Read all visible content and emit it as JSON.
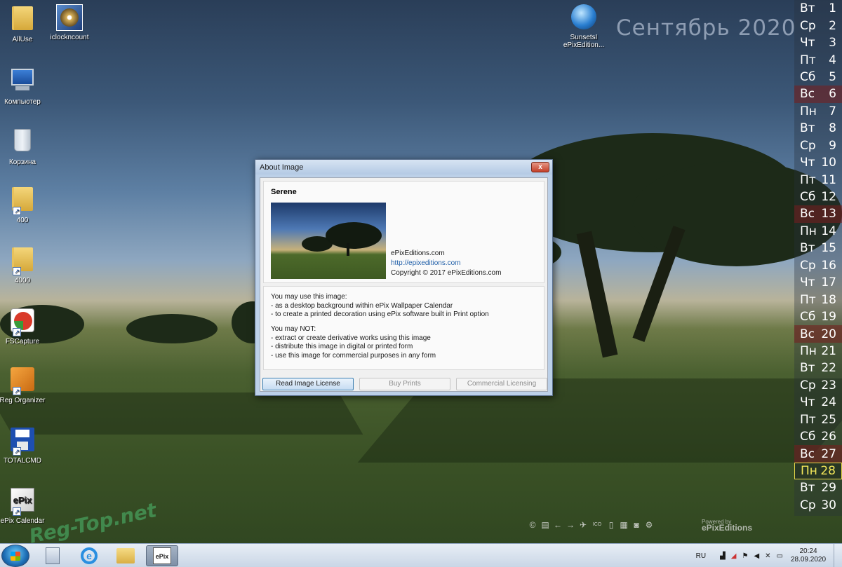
{
  "desktop": {
    "icons": [
      {
        "label": "AllUse"
      },
      {
        "label": "iclockncount"
      },
      {
        "label": "Компьютер"
      },
      {
        "label": "Корзина"
      },
      {
        "label": "400"
      },
      {
        "label": "4000"
      },
      {
        "label": "FSCapture"
      },
      {
        "label": "Reg Organizer"
      },
      {
        "label": "TOTALCMD"
      },
      {
        "label": "ePix Calendar"
      },
      {
        "label_line1": "SunsetsI",
        "label_line2": "ePixEdition..."
      }
    ],
    "month_title": "Сентябрь 2020",
    "watermark": "Reg-Top.net"
  },
  "calendar": {
    "days": [
      {
        "dow": "Вт",
        "day": "1"
      },
      {
        "dow": "Ср",
        "day": "2"
      },
      {
        "dow": "Чт",
        "day": "3"
      },
      {
        "dow": "Пт",
        "day": "4"
      },
      {
        "dow": "Сб",
        "day": "5"
      },
      {
        "dow": "Вс",
        "day": "6"
      },
      {
        "dow": "Пн",
        "day": "7"
      },
      {
        "dow": "Вт",
        "day": "8"
      },
      {
        "dow": "Ср",
        "day": "9"
      },
      {
        "dow": "Чт",
        "day": "10"
      },
      {
        "dow": "Пт",
        "day": "11"
      },
      {
        "dow": "Сб",
        "day": "12"
      },
      {
        "dow": "Вс",
        "day": "13"
      },
      {
        "dow": "Пн",
        "day": "14"
      },
      {
        "dow": "Вт",
        "day": "15"
      },
      {
        "dow": "Ср",
        "day": "16"
      },
      {
        "dow": "Чт",
        "day": "17"
      },
      {
        "dow": "Пт",
        "day": "18"
      },
      {
        "dow": "Сб",
        "day": "19"
      },
      {
        "dow": "Вс",
        "day": "20"
      },
      {
        "dow": "Пн",
        "day": "21"
      },
      {
        "dow": "Вт",
        "day": "22"
      },
      {
        "dow": "Ср",
        "day": "23"
      },
      {
        "dow": "Чт",
        "day": "24"
      },
      {
        "dow": "Пт",
        "day": "25"
      },
      {
        "dow": "Сб",
        "day": "26"
      },
      {
        "dow": "Вс",
        "day": "27"
      },
      {
        "dow": "Пн",
        "day": "28"
      },
      {
        "dow": "Вт",
        "day": "29"
      },
      {
        "dow": "Ср",
        "day": "30"
      }
    ],
    "today": "28",
    "weekend_color": "#7a1e1e",
    "today_color": "#e8d94a"
  },
  "dialog": {
    "title": "About Image",
    "close_glyph": "x",
    "image_title": "Serene",
    "publisher": "ePixEditions.com",
    "url": "http://epixeditions.com",
    "copyright": "Copyright © 2017 ePixEditions.com",
    "may_use_heading": "You may use this image:",
    "may_use": [
      "- as a desktop background within ePix Wallpaper Calendar",
      "- to create a printed decoration using ePix software built in Print option"
    ],
    "may_not_heading": "You may NOT:",
    "may_not": [
      "- extract or create derivative works using this image",
      "- distribute this image in digital or printed form",
      "- use this image for commercial purposes in any form"
    ],
    "buttons": {
      "read_license": "Read Image License",
      "buy_prints": "Buy Prints",
      "commercial": "Commercial Licensing"
    }
  },
  "toolbar": {
    "icons": [
      "copyright-icon",
      "print-icon",
      "back-icon",
      "forward-icon",
      "send-icon",
      "ico-icon",
      "info-icon",
      "grid-icon",
      "camera-icon",
      "settings-icon"
    ],
    "ico_text": "ICO",
    "powered_line1": "Powered by",
    "powered_line2": "ePixEditions"
  },
  "taskbar": {
    "language": "RU",
    "time": "20:24",
    "date": "28.09.2020"
  }
}
